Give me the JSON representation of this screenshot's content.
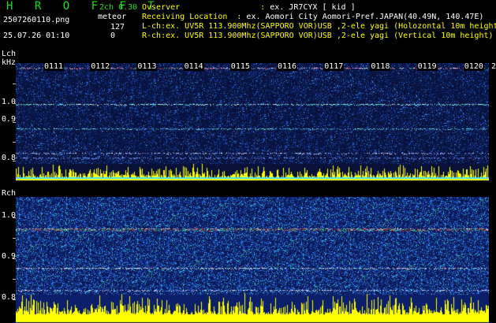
{
  "header": {
    "brand": "H R O F F T",
    "mode": "2ch 0.30",
    "filename": "2507260110.png",
    "meteor_label": "meteor",
    "lch_count": "127",
    "rch_count": "0",
    "datetime": "25.07.26 01:10"
  },
  "station": {
    "observer_label": "Ovserver",
    "observer_value": "ex. JR7CYX [ kid ]",
    "location_label": "Receiving Location",
    "location_value": "ex. Aomori City Aomori-Pref.JAPAN(40.49N, 140.47E)",
    "lch_line": "L-ch:ex. UV5R 113.900Mhz(SAPPORO VOR)USB ,2-ele yagi (Holozontal 10m height)",
    "rch_line": "R-ch:ex. UV5R 113.900Mhz(SAPPORO VOR)USB ,2-ele yagi (Vertical 10m height)"
  },
  "lch": {
    "label": "Lch",
    "unit": "kHz",
    "yticks": [
      "1.0",
      "0.9",
      "0.8"
    ]
  },
  "rch": {
    "label": "Rch",
    "yticks": [
      "1.0",
      "0.9",
      "0.8"
    ]
  },
  "time_ticks": [
    "0111",
    "0112",
    "0113",
    "0114",
    "0115",
    "0116",
    "0117",
    "0118",
    "0119",
    "0120",
    "2"
  ],
  "colors": {
    "brand": "#18e018",
    "info": "#ffff00",
    "noise_base": "#0b1a4e",
    "bars": "#ffff00"
  }
}
